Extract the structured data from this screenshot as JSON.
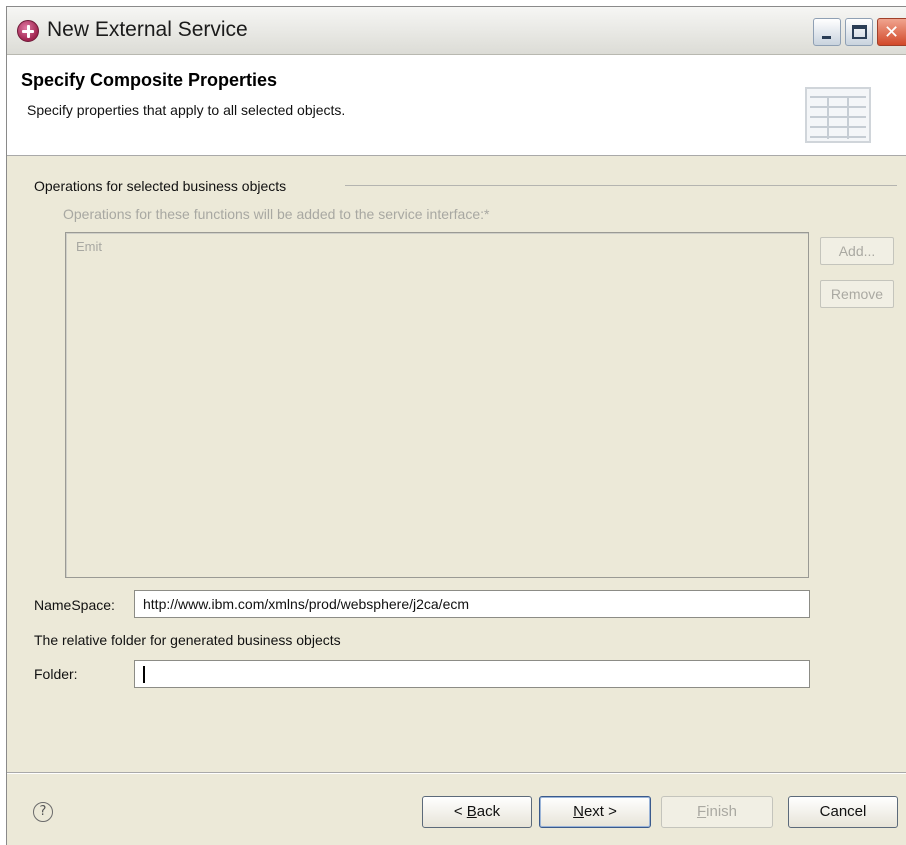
{
  "window": {
    "title": "New External Service"
  },
  "header": {
    "title": "Specify Composite Properties",
    "description": "Specify properties that apply to all selected objects."
  },
  "operations": {
    "group_label": "Operations for selected business objects",
    "sub_label": "Operations for these functions will be added to the service interface:*",
    "items": [
      "Emit"
    ],
    "add_label": "Add...",
    "remove_label": "Remove"
  },
  "namespace": {
    "label": "NameSpace:",
    "value": "http://www.ibm.com/xmlns/prod/websphere/j2ca/ecm"
  },
  "folder": {
    "description": "The relative folder for generated business objects",
    "label": "Folder:",
    "value": ""
  },
  "footer": {
    "help_symbol": "?",
    "back_prefix": "< ",
    "back_mnemonic": "B",
    "back_rest": "ack",
    "next_mnemonic": "N",
    "next_rest": "ext >",
    "finish_mnemonic": "F",
    "finish_rest": "inish",
    "cancel_label": "Cancel"
  },
  "colors": {
    "dialog_bg": "#ece9d8",
    "disabled_text": "#aaa9a2",
    "close_button": "#d2492a"
  }
}
